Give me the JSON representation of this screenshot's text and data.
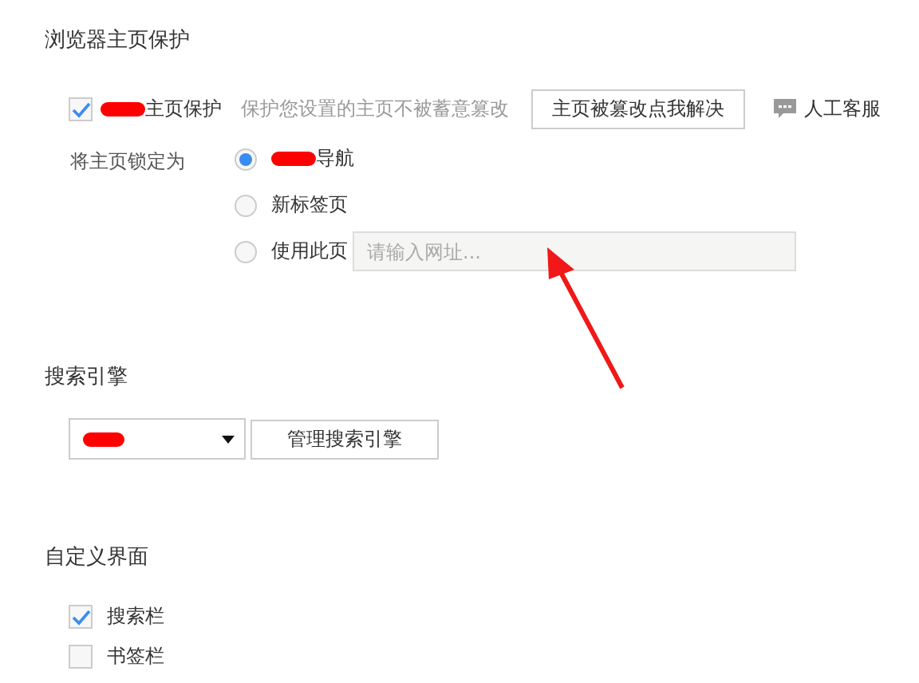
{
  "homepage_protection": {
    "title": "浏览器主页保护",
    "protect": {
      "label": "主页保护",
      "checked": true,
      "redacted": true
    },
    "description": "保护您设置的主页不被蓄意篡改",
    "fix_button": "主页被篡改点我解决",
    "support_link": "人工客服",
    "lock_label": "将主页锁定为",
    "options": [
      {
        "label": "导航",
        "selected": true,
        "redacted": true,
        "kind": "plain"
      },
      {
        "label": "新标签页",
        "selected": false,
        "redacted": false,
        "kind": "plain"
      },
      {
        "label": "使用此页",
        "selected": false,
        "redacted": false,
        "kind": "url",
        "placeholder": "请输入网址..."
      }
    ]
  },
  "search_engine": {
    "title": "搜索引擎",
    "dropdown": {
      "redacted": true
    },
    "manage_button": "管理搜索引擎"
  },
  "custom_ui": {
    "title": "自定义界面",
    "items": [
      {
        "label": "搜索栏",
        "checked": true
      },
      {
        "label": "书签栏",
        "checked": false
      }
    ]
  },
  "annotation": {
    "arrow": true
  }
}
